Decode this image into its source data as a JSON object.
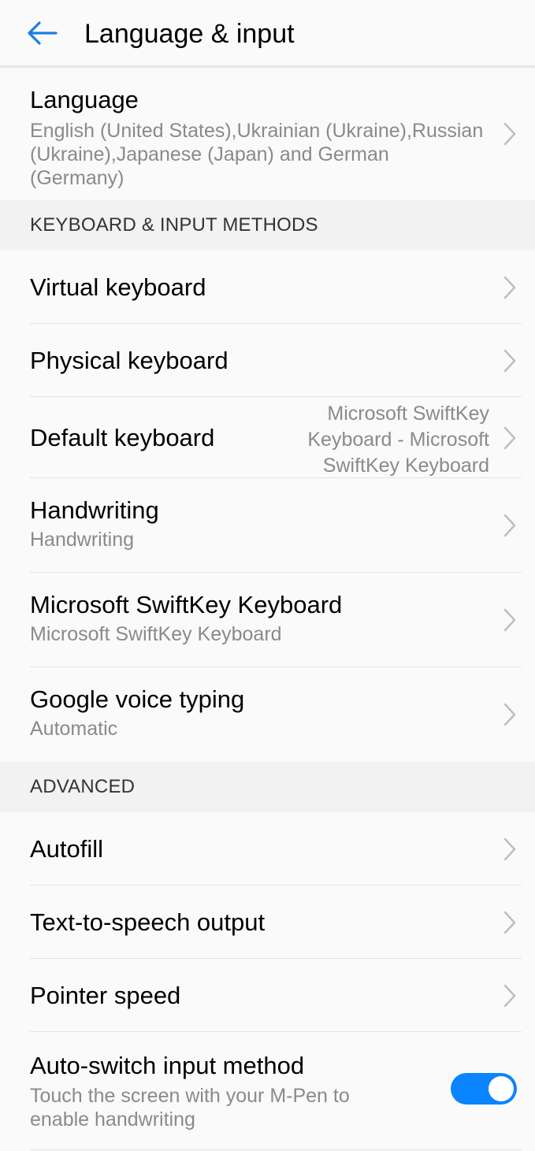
{
  "header": {
    "title": "Language & input",
    "back_icon": "arrow-left-icon",
    "accent_color": "#1a7fe0"
  },
  "language": {
    "title": "Language",
    "value": "English (United States),Ukrainian (Ukraine),Russian (Ukraine),Japanese (Japan) and German (Germany)"
  },
  "sections": {
    "keyboard": "KEYBOARD & INPUT METHODS",
    "advanced": "ADVANCED"
  },
  "keyboard": {
    "virtual": "Virtual keyboard",
    "physical": "Physical keyboard",
    "default_title": "Default keyboard",
    "default_value": "Microsoft SwiftKey Keyboard - Microsoft SwiftKey Keyboard",
    "handwriting_title": "Handwriting",
    "handwriting_sub": "Handwriting",
    "swiftkey_title": "Microsoft SwiftKey Keyboard",
    "swiftkey_sub": "Microsoft SwiftKey Keyboard",
    "voice_title": "Google voice typing",
    "voice_sub": "Automatic"
  },
  "advanced": {
    "autofill": "Autofill",
    "tts": "Text-to-speech output",
    "pointer": "Pointer speed",
    "autoswitch_title": "Auto-switch input method",
    "autoswitch_sub": "Touch the screen with your M-Pen to enable handwriting",
    "autoswitch_on": true,
    "toggle_color": "#0a84ff"
  },
  "icons": {
    "chevron": "chevron-right-icon"
  }
}
